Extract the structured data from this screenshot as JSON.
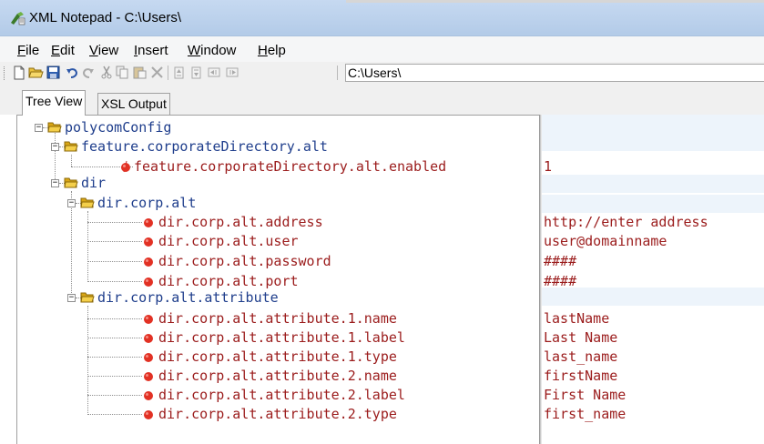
{
  "window": {
    "title": "XML Notepad - C:\\Users\\"
  },
  "menu": [
    "File",
    "Edit",
    "View",
    "Insert",
    "Window",
    "Help"
  ],
  "toolbar": {
    "icons": [
      "new-icon",
      "open-icon",
      "save-icon",
      "undo-icon",
      "redo-icon",
      "cut-icon",
      "copy-icon",
      "paste-icon",
      "delete-icon",
      "nudge-up-icon",
      "nudge-down-icon",
      "nudge-left-icon",
      "nudge-right-icon"
    ],
    "path": "C:\\Users\\"
  },
  "tabs": [
    {
      "label": "Tree View",
      "active": true
    },
    {
      "label": "XSL Output",
      "active": false
    }
  ],
  "tree": [
    {
      "label": "polycomConfig",
      "kind": "folder",
      "depth": 0,
      "value": ""
    },
    {
      "label": "feature.corporateDirectory.alt",
      "kind": "folder",
      "depth": 1,
      "value": ""
    },
    {
      "label": "feature.corporateDirectory.alt.enabled",
      "kind": "attr",
      "depth": 2,
      "value": "1"
    },
    {
      "label": "dir",
      "kind": "folder",
      "depth": 1,
      "value": ""
    },
    {
      "label": "dir.corp.alt",
      "kind": "folder",
      "depth": 2,
      "value": ""
    },
    {
      "label": "dir.corp.alt.address",
      "kind": "attr",
      "depth": 3,
      "value": "http://enter address"
    },
    {
      "label": "dir.corp.alt.user",
      "kind": "attr",
      "depth": 3,
      "value": "user@domainname"
    },
    {
      "label": "dir.corp.alt.password",
      "kind": "attr",
      "depth": 3,
      "value": "####"
    },
    {
      "label": "dir.corp.alt.port",
      "kind": "attr",
      "depth": 3,
      "value": "####"
    },
    {
      "label": "dir.corp.alt.attribute",
      "kind": "folder",
      "depth": 2,
      "value": ""
    },
    {
      "label": "dir.corp.alt.attribute.1.name",
      "kind": "attr",
      "depth": 3,
      "value": "lastName"
    },
    {
      "label": "dir.corp.alt.attribute.1.label",
      "kind": "attr",
      "depth": 3,
      "value": "Last Name"
    },
    {
      "label": "dir.corp.alt.attribute.1.type",
      "kind": "attr",
      "depth": 3,
      "value": "last_name"
    },
    {
      "label": "dir.corp.alt.attribute.2.name",
      "kind": "attr",
      "depth": 3,
      "value": "firstName"
    },
    {
      "label": "dir.corp.alt.attribute.2.label",
      "kind": "attr",
      "depth": 3,
      "value": "First Name"
    },
    {
      "label": "dir.corp.alt.attribute.2.type",
      "kind": "attr",
      "depth": 3,
      "value": "first_name"
    }
  ],
  "colors": {
    "folder_text": "#1f3e8c",
    "attr_text": "#9b1c1c",
    "folder_icon": "#e8b923",
    "attr_bullet": "#d9261c"
  }
}
